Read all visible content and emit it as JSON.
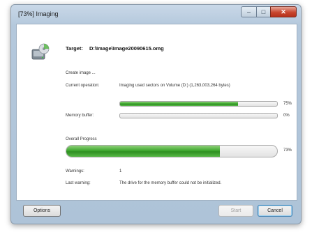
{
  "window": {
    "title": "[73%] Imaging"
  },
  "caption": {
    "min": "–",
    "max": "□",
    "close": "✕"
  },
  "header": {
    "target_label": "Target:",
    "target_value": "D:\\Image\\Image20090615.omg"
  },
  "status": {
    "create_image": "Create image ...",
    "current_operation_label": "Current operation:",
    "current_operation_value": "Imaging used sectors on Volume (D:) (1,263,003,264 bytes)"
  },
  "progress": {
    "current": {
      "percent_text": "75%",
      "value": 0.75
    },
    "memory_buffer": {
      "label": "Memory buffer:",
      "percent_text": "0%",
      "value": 0.0
    },
    "overall": {
      "label": "Overall Progress",
      "percent_text": "73%",
      "value": 0.73
    }
  },
  "warnings": {
    "count_label": "Warnings:",
    "count_value": "1",
    "last_label": "Last warning:",
    "last_value": "The drive for the memory buffer could not be initialized."
  },
  "buttons": {
    "options": "Options",
    "start": "Start",
    "cancel": "Cancel"
  },
  "colors": {
    "progress_green": "#3fa82f",
    "window_frame": "#b4c8dc",
    "close_red": "#c8472f"
  },
  "icons": {
    "app": "imaging-drive-icon"
  }
}
